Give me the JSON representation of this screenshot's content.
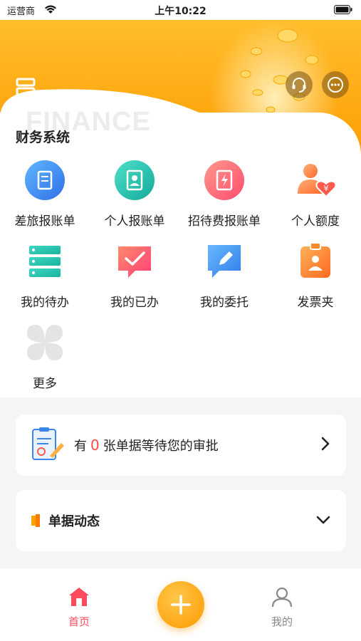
{
  "status_bar": {
    "carrier": "运营商",
    "time": "上午10:22"
  },
  "hero": {
    "watermark": "FINANCE"
  },
  "section": {
    "title": "财务系统"
  },
  "grid": [
    {
      "label": "差旅报账单",
      "icon": "travel-expense-icon"
    },
    {
      "label": "个人报账单",
      "icon": "personal-expense-icon"
    },
    {
      "label": "招待费报账单",
      "icon": "entertainment-expense-icon"
    },
    {
      "label": "个人额度",
      "icon": "personal-quota-icon"
    },
    {
      "label": "我的待办",
      "icon": "todo-icon"
    },
    {
      "label": "我的已办",
      "icon": "done-icon"
    },
    {
      "label": "我的委托",
      "icon": "delegate-icon"
    },
    {
      "label": "发票夹",
      "icon": "invoice-folder-icon"
    },
    {
      "label": "更多",
      "icon": "more-apps-icon"
    }
  ],
  "approval": {
    "prefix": "有",
    "count": "0",
    "suffix": "张单据等待您的审批"
  },
  "dynamics": {
    "title": "单据动态"
  },
  "tabbar": {
    "home": "首页",
    "mine": "我的"
  },
  "colors": {
    "accent_orange": "#ffa200",
    "accent_red": "#ff4b5c"
  }
}
